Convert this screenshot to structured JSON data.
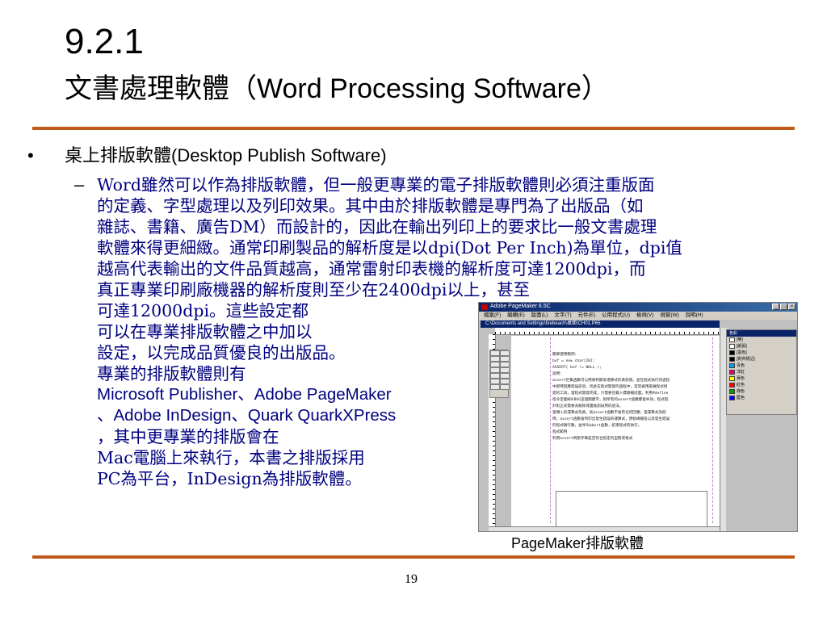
{
  "heading": {
    "number": "9.2.1",
    "title_cjk": "文書處理軟體（",
    "title_en": "Word Processing Software",
    "title_close": "）"
  },
  "bullet": {
    "marker": "•",
    "label_cjk": "桌上排版軟體",
    "label_en": "(Desktop Publish Software)"
  },
  "sub_bullet": {
    "marker": "–",
    "lines": [
      "Word雖然可以作為排版軟體，但一般更專業的電子排版軟體則必須注重版面",
      "的定義、字型處理以及列印效果。其中由於排版軟體是專門為了出版品（如",
      "雜誌、書籍、廣告DM）而設計的，因此在輸出列印上的要求比一般文書處理",
      "軟體來得更細緻。通常印刷製品的解析度是以dpi(Dot Per Inch)為單位，dpi值",
      "越高代表輸出的文件品質越高，通常雷射印表機的解析度可達1200dpi，而",
      "真正專業印刷廠機器的解析度則至少在2400dpi以上，甚至",
      "可達12000dpi。這些設定都",
      "可以在專業排版軟體之中加以",
      "設定，以完成品質優良的出版品。",
      "專業的排版軟體則有",
      "Microsoft Publisher、Adobe PageMaker",
      "、Adobe InDesign、Quark QuarkXPress",
      "，其中更專業的排版會在",
      "Mac電腦上來執行，本書之排版採用",
      "PC為平台，InDesign為排版軟體。"
    ]
  },
  "screenshot": {
    "window_title": "Adobe PageMaker 6.5C",
    "menu": [
      "檔案(F)",
      "編輯(E)",
      "版面(L)",
      "文字(T)",
      "元件(E)",
      "公用程式(U)",
      "檢視(V)",
      "視窗(W)",
      "說明(H)"
    ],
    "document_title": "C:\\Documents and Settings\\firebeach\\桌面\\CH01.P65",
    "page_text": [
      "簡單使用範例：",
      "    buf = new char[20];",
      "    ASSERT( buf != NULL );",
      "說明：",
      "    assert巨集函數可以用來判斷某運算式的真假值，並在程式執行的過程",
      "    中即時回應錯誤訊息，因此在程式開發的過程中，常常被用來做程式偵",
      "    錯的工具，當程式開發完成，只需要在載入標頭檔前面，利用#define",
      "    指令定義NDEBUG這個關鍵字，則所有的assert函數都會失效，程式就",
      "    針對正式需要去刪除或置換測試用的語法。",
      "    當傳入的運算式為真，則assert函數不會有任何回應；當運算式為假",
      "    時，assert函數會列印出發生錯誤的運算式，原始碼檔名以及發生錯誤",
      "    的程式碼行數，並呼叫abort函數，結束程式的執行。",
      "程式範例",
      "    利用assert判斷字串是否符合指定的型態或格式"
    ],
    "panel_title": "色彩",
    "swatches": [
      {
        "name": "[無]",
        "color": "#ffffff"
      },
      {
        "name": "[紙張]",
        "color": "#ffffff"
      },
      {
        "name": "[黑色]",
        "color": "#000000"
      },
      {
        "name": "[對齊標記]",
        "color": "#000000"
      },
      {
        "name": "青色",
        "color": "#00a0e0"
      },
      {
        "name": "洋紅",
        "color": "#e0007a"
      },
      {
        "name": "黃色",
        "color": "#ffff00"
      },
      {
        "name": "紅色",
        "color": "#ff0000"
      },
      {
        "name": "綠色",
        "color": "#00a000"
      },
      {
        "name": "藍色",
        "color": "#0000ff"
      }
    ]
  },
  "caption": {
    "en": "PageMaker",
    "cjk": "排版軟體"
  },
  "page_number": "19",
  "colors": {
    "rule": "#c05a1a",
    "body_text": "#000080"
  }
}
